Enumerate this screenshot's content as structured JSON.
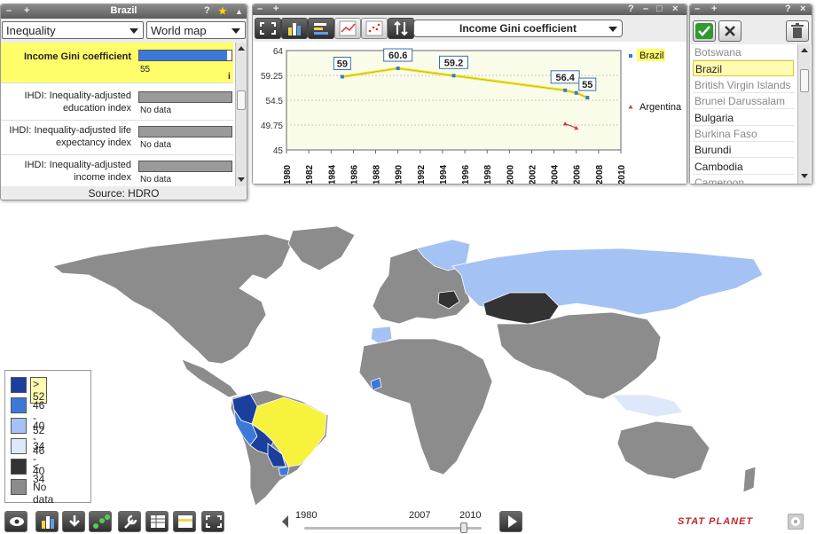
{
  "indicator_panel": {
    "title": "Brazil",
    "controls": {
      "help": "?",
      "star": "★",
      "collapse": "▲",
      "add": "+",
      "minimize": "–"
    },
    "category_select": "Inequality",
    "view_select": "World map",
    "indicators": [
      {
        "name": "Income Gini coefficient",
        "value": "55",
        "fill": 0.95,
        "selected": true
      },
      {
        "name": "IHDI: Inequality-adjusted education index",
        "value": "No data",
        "fill": 0,
        "selected": false
      },
      {
        "name": "IHDI: Inequality-adjusted life expectancy index",
        "value": "No data",
        "fill": 0,
        "selected": false
      },
      {
        "name": "IHDI: Inequality-adjusted income index",
        "value": "No data",
        "fill": 0,
        "selected": false
      }
    ],
    "info_icon": "i",
    "source": "Source: HDRO"
  },
  "graph_panel": {
    "controls": {
      "help": "?",
      "minimize": "–",
      "maximize": "□",
      "close": "×",
      "add": "+"
    },
    "title_select": "Income Gini coefficient",
    "toolbar_icons": [
      "fullscreen-icon",
      "bar-chart-icon",
      "horizontal-bar-icon",
      "line-chart-icon",
      "scatter-icon",
      "sort-icon"
    ]
  },
  "chart_data": {
    "type": "line",
    "title": "Income Gini coefficient",
    "ylim": [
      45,
      64
    ],
    "yticks": [
      "64",
      "59.25",
      "54.5",
      "49.75",
      "45"
    ],
    "xlim": [
      1980,
      2010
    ],
    "xticks": [
      "1980",
      "1982",
      "1984",
      "1986",
      "1988",
      "1990",
      "1992",
      "1994",
      "1996",
      "1998",
      "2000",
      "2002",
      "2004",
      "2006",
      "2008",
      "2010"
    ],
    "series": [
      {
        "name": "Brazil",
        "color": "#3b78c8",
        "line_color": "#f3e62a",
        "points": [
          [
            1985,
            59
          ],
          [
            1990,
            60.6
          ],
          [
            1995,
            59.2
          ],
          [
            2005,
            56.4
          ],
          [
            2006,
            55.9
          ],
          [
            2007,
            55
          ]
        ],
        "labels": [
          {
            "x": 1985,
            "y": 59,
            "text": "59"
          },
          {
            "x": 1990,
            "y": 60.6,
            "text": "60.6"
          },
          {
            "x": 1995,
            "y": 59.2,
            "text": "59.2"
          },
          {
            "x": 2005,
            "y": 56.4,
            "text": "56.4"
          },
          {
            "x": 2007,
            "y": 55,
            "text": "55"
          }
        ]
      },
      {
        "name": "Argentina",
        "color": "#d23b3b",
        "line_color": "#d23b3b",
        "points": [
          [
            2005,
            50
          ],
          [
            2006,
            49.2
          ]
        ],
        "labels": []
      }
    ],
    "grid": true,
    "legend": "right"
  },
  "country_panel": {
    "controls": {
      "help": "?",
      "close": "×",
      "add": "+"
    },
    "buttons": {
      "accept": "check-icon",
      "reject": "x-icon",
      "delete": "trash-icon"
    },
    "countries": [
      {
        "name": "Botswana",
        "available": false,
        "selected": false
      },
      {
        "name": "Brazil",
        "available": true,
        "selected": true
      },
      {
        "name": "British Virgin Islands",
        "available": false,
        "selected": false
      },
      {
        "name": "Brunei Darussalam",
        "available": false,
        "selected": false
      },
      {
        "name": "Bulgaria",
        "available": true,
        "selected": false
      },
      {
        "name": "Burkina Faso",
        "available": false,
        "selected": false
      },
      {
        "name": "Burundi",
        "available": true,
        "selected": false
      },
      {
        "name": "Cambodia",
        "available": true,
        "selected": false
      },
      {
        "name": "Cameroon",
        "available": false,
        "selected": false
      }
    ]
  },
  "legend": {
    "items": [
      {
        "label": "> 52",
        "color": "#1a3f9c",
        "highlight": true
      },
      {
        "label": "46 - 52",
        "color": "#3c78d8",
        "highlight": false
      },
      {
        "label": "40 - 46",
        "color": "#a4c2f4",
        "highlight": false
      },
      {
        "label": "34 - 40",
        "color": "#dde8fb",
        "highlight": false
      },
      {
        "label": "< 34",
        "color": "#333333",
        "highlight": false
      },
      {
        "label": "No data",
        "color": "#8c8c8c",
        "highlight": false
      }
    ]
  },
  "timeline": {
    "start": "1980",
    "current": "2007",
    "end": "2010",
    "position": 0.9
  },
  "brand": "STAT PLANET"
}
